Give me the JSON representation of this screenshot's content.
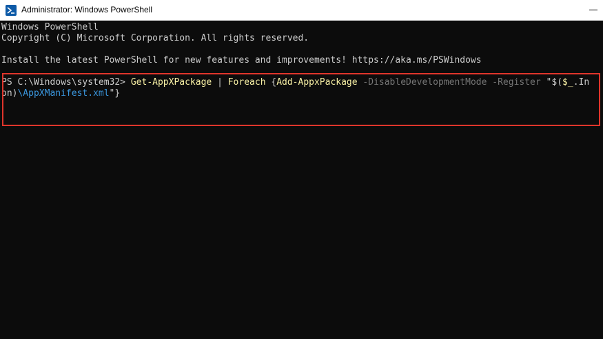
{
  "window": {
    "title": "Administrator: Windows PowerShell",
    "icon": "powershell-icon",
    "controls": [
      "minimize-icon"
    ]
  },
  "console": {
    "lines": [
      "Windows PowerShell",
      "Copyright (C) Microsoft Corporation. All rights reserved.",
      "",
      "Install the latest PowerShell for new features and improvements! https://aka.ms/PSWindows"
    ],
    "command": {
      "prompt": "PS C:\\Windows\\system32> ",
      "cmdlet1": "Get-AppXPackage",
      "pipe": " | ",
      "cmdlet2": "Foreach",
      "brace_open": " {",
      "cmdlet3": "Add-AppxPackage",
      "param1": " -DisableDevelopmentMode",
      "param2": " -Register",
      "string_start": " \"$(",
      "var": "$_",
      "wrap_part1": ".In",
      "wrap_part2": "on)",
      "path": "\\AppXManifest.xml",
      "string_end": "\"}"
    }
  },
  "colors": {
    "background": "#0c0c0c",
    "text": "#cccccc",
    "cmdlet": "#f9f1a5",
    "parameter": "#767676",
    "string": "#3a96dd",
    "highlight": "#e0352b"
  }
}
